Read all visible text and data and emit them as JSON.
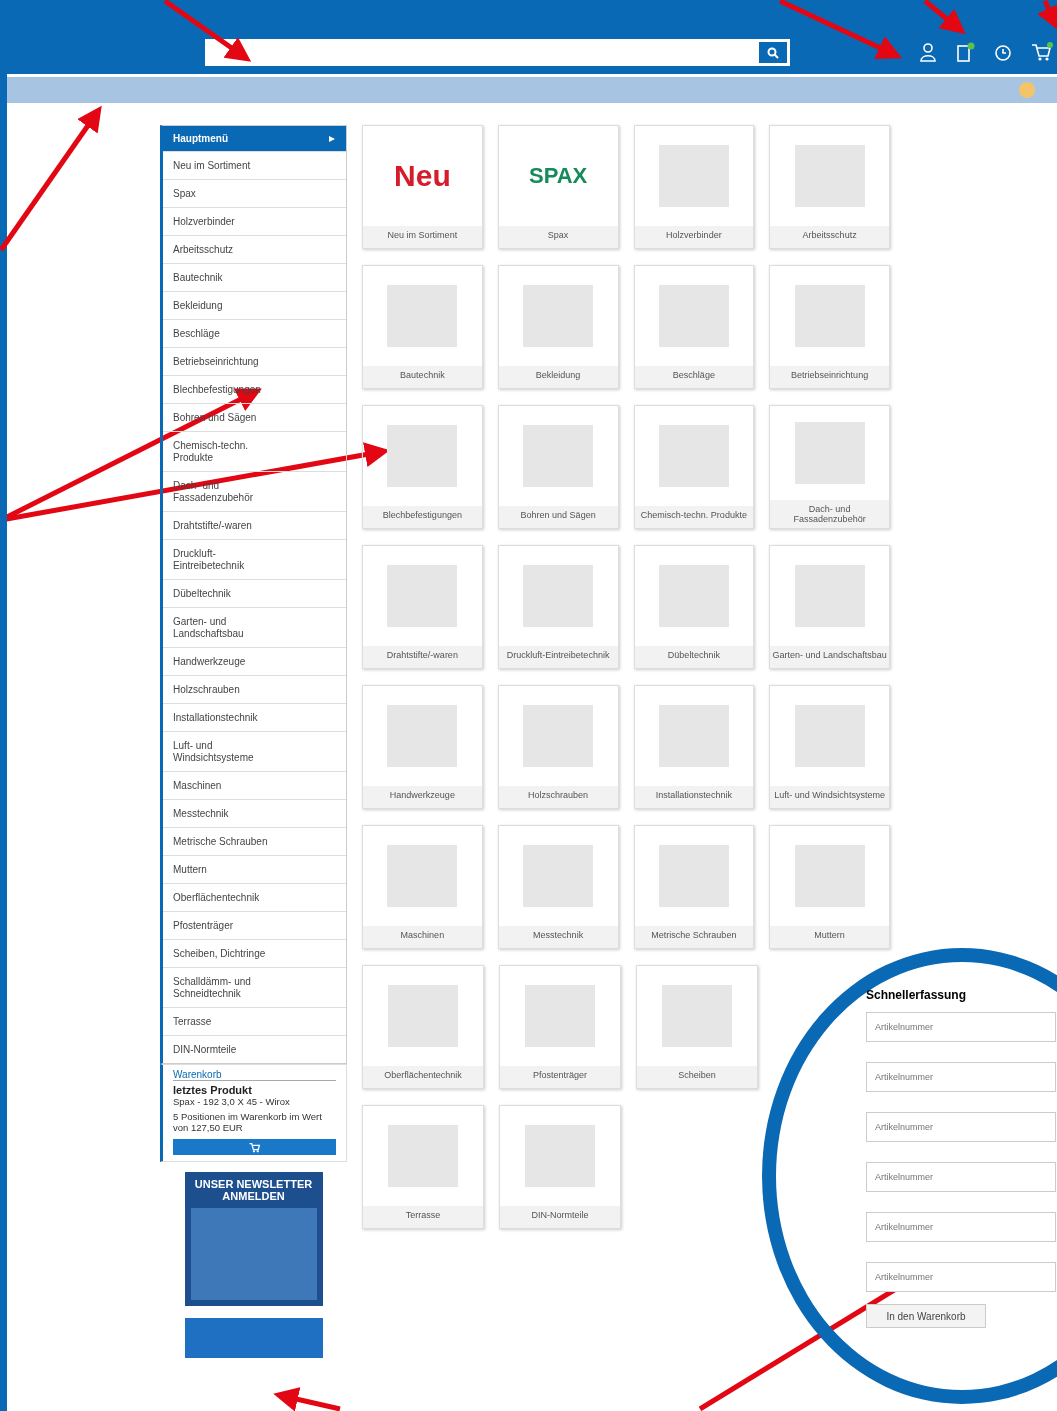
{
  "sidebar": {
    "title": "Hauptmenü",
    "items": [
      "Neu im Sortiment",
      "Spax",
      "Holzverbinder",
      "Arbeitsschutz",
      "Bautechnik",
      "Bekleidung",
      "Beschläge",
      "Betriebseinrichtung",
      "Blechbefestigungen",
      "Bohren und Sägen",
      "Chemisch-techn. Produkte",
      "Dach- und Fassadenzubehör",
      "Drahtstifte/-waren",
      "Druckluft-Eintreibetechnik",
      "Dübeltechnik",
      "Garten- und Landschaftsbau",
      "Handwerkzeuge",
      "Holzschrauben",
      "Installationstechnik",
      "Luft- und Windsichtsysteme",
      "Maschinen",
      "Messtechnik",
      "Metrische Schrauben",
      "Muttern",
      "Oberflächentechnik",
      "Pfostenträger",
      "Scheiben, Dichtringe",
      "Schalldämm- und Schneidtechnik",
      "Terrasse",
      "DIN-Normteile"
    ]
  },
  "cart": {
    "title": "Warenkorb",
    "last_label": "letztes Produkt",
    "last_product": "Spax - 192 3,0 X 45 - Wirox",
    "summary": "5 Positionen im Warenkorb im Wert von 127,50 EUR"
  },
  "newsletter": {
    "headline": "UNSER NEWSLETTER ANMELDEN"
  },
  "category_rows": [
    [
      {
        "label": "Neu im Sortiment",
        "logo": "Neu",
        "kind": "text-logo"
      },
      {
        "label": "Spax",
        "logo": "SPAX",
        "kind": "brand-logo"
      },
      {
        "label": "Holzverbinder",
        "kind": "photo"
      },
      {
        "label": "Arbeitsschutz",
        "kind": "photo"
      }
    ],
    [
      {
        "label": "Bautechnik",
        "kind": "photo"
      },
      {
        "label": "Bekleidung",
        "kind": "photo"
      },
      {
        "label": "Beschläge",
        "kind": "photo"
      },
      {
        "label": "Betriebseinrichtung",
        "kind": "photo"
      }
    ],
    [
      {
        "label": "Blechbefestigungen",
        "kind": "photo"
      },
      {
        "label": "Bohren und Sägen",
        "kind": "photo"
      },
      {
        "label": "Chemisch-techn. Produkte",
        "kind": "photo"
      },
      {
        "label": "Dach- und Fassadenzubehör",
        "kind": "photo"
      }
    ],
    [
      {
        "label": "Drahtstifte/-waren",
        "kind": "photo"
      },
      {
        "label": "Druckluft-Eintreibetechnik",
        "kind": "photo"
      },
      {
        "label": "Dübeltechnik",
        "kind": "photo"
      },
      {
        "label": "Garten- und Landschaftsbau",
        "kind": "photo"
      }
    ],
    [
      {
        "label": "Handwerkzeuge",
        "kind": "photo"
      },
      {
        "label": "Holzschrauben",
        "kind": "photo"
      },
      {
        "label": "Installationstechnik",
        "kind": "photo"
      },
      {
        "label": "Luft- und Windsichtsysteme",
        "kind": "photo"
      }
    ],
    [
      {
        "label": "Maschinen",
        "kind": "photo"
      },
      {
        "label": "Messtechnik",
        "kind": "photo"
      },
      {
        "label": "Metrische Schrauben",
        "kind": "photo"
      },
      {
        "label": "Muttern",
        "kind": "photo"
      }
    ],
    [
      {
        "label": "Oberflächentechnik",
        "kind": "photo"
      },
      {
        "label": "Pfostenträger",
        "kind": "photo"
      },
      {
        "label": "Scheiben",
        "kind": "photo"
      }
    ],
    [
      {
        "label": "Terrasse",
        "kind": "photo"
      },
      {
        "label": "DIN-Normteile",
        "kind": "photo"
      }
    ]
  ],
  "quick_entry": {
    "title": "Schnellerfassung",
    "fields": [
      {
        "placeholder": "Artikelnummer"
      },
      {
        "placeholder": "Artikelnummer"
      },
      {
        "placeholder": "Artikelnummer"
      },
      {
        "placeholder": "Artikelnummer"
      },
      {
        "placeholder": "Artikelnummer"
      },
      {
        "placeholder": "Artikelnummer"
      }
    ],
    "button": "In den Warenkorb"
  }
}
